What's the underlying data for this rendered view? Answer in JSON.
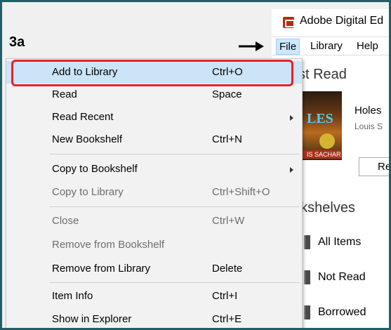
{
  "step_label": "3a",
  "app": {
    "title": "Adobe Digital Ed",
    "menubar": {
      "file": "File",
      "library": "Library",
      "help": "Help"
    }
  },
  "content": {
    "last_read_heading": "st Read",
    "book": {
      "title": "Holes",
      "author": "Louis S",
      "read_button": "Re",
      "cover_text": "LES",
      "cover_author": "IS SACHAR"
    },
    "bookshelves_heading": "okshelves",
    "shelves": [
      "All Items",
      "Not Read",
      "Borrowed"
    ]
  },
  "file_menu": {
    "items": [
      {
        "label": "Add to Library",
        "shortcut": "Ctrl+O",
        "enabled": true,
        "highlighted": true
      },
      {
        "label": "Read",
        "shortcut": "Space",
        "enabled": true
      },
      {
        "label": "Read Recent",
        "shortcut": "",
        "enabled": true,
        "submenu": true
      },
      {
        "label": "New Bookshelf",
        "shortcut": "Ctrl+N",
        "enabled": true
      },
      {
        "label": "Copy to Bookshelf",
        "shortcut": "",
        "enabled": true,
        "submenu": true
      },
      {
        "label": "Copy to Library",
        "shortcut": "Ctrl+Shift+O",
        "enabled": false
      },
      {
        "label": "Close",
        "shortcut": "Ctrl+W",
        "enabled": false
      },
      {
        "label": "Remove from Bookshelf",
        "shortcut": "",
        "enabled": false
      },
      {
        "label": "Remove from Library",
        "shortcut": "Delete",
        "enabled": true
      },
      {
        "label": "Item Info",
        "shortcut": "Ctrl+I",
        "enabled": true
      },
      {
        "label": "Show in Explorer",
        "shortcut": "Ctrl+E",
        "enabled": true
      }
    ]
  },
  "colors": {
    "highlight_outline": "#e8202a",
    "menu_hover": "#cce4f7",
    "frame_border": "#1f5f66"
  }
}
